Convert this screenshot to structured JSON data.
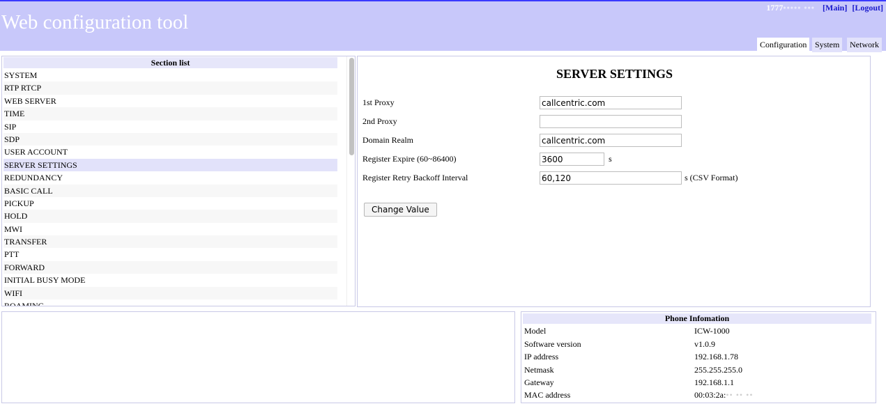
{
  "header": {
    "title": "Web configuration tool",
    "user_prefix": "1777",
    "user_redacted": "••••• •••",
    "main_link": "[Main]",
    "logout_link": "[Logout]"
  },
  "tabs": [
    {
      "label": "Configuration",
      "active": true
    },
    {
      "label": "System",
      "active": false
    },
    {
      "label": "Network",
      "active": false
    }
  ],
  "section_list": {
    "header": "Section list",
    "items": [
      "SYSTEM",
      "RTP RTCP",
      "WEB SERVER",
      "TIME",
      "SIP",
      "SDP",
      "USER ACCOUNT",
      "SERVER SETTINGS",
      "REDUNDANCY",
      "BASIC CALL",
      "PICKUP",
      "HOLD",
      "MWI",
      "TRANSFER",
      "PTT",
      "FORWARD",
      "INITIAL BUSY MODE",
      "WIFI",
      "ROAMING"
    ],
    "selected": "SERVER SETTINGS"
  },
  "settings": {
    "title": "SERVER SETTINGS",
    "fields": {
      "proxy1": {
        "label": "1st Proxy",
        "value": "callcentric.com"
      },
      "proxy2": {
        "label": "2nd Proxy",
        "value": ""
      },
      "domain": {
        "label": "Domain Realm",
        "value": "callcentric.com"
      },
      "expire": {
        "label": "Register Expire (60~86400)",
        "value": "3600",
        "unit": "s"
      },
      "retry": {
        "label": "Register Retry Backoff Interval",
        "value": "60,120",
        "unit": "s (CSV Format)"
      }
    },
    "button": "Change Value"
  },
  "phone_info": {
    "header": "Phone Infomation",
    "model": {
      "label": "Model",
      "value": "ICW-1000"
    },
    "software": {
      "label": "Software version",
      "value": "v1.0.9"
    },
    "ip": {
      "label": "IP address",
      "value": "192.168.1.78"
    },
    "netmask": {
      "label": "Netmask",
      "value": "255.255.255.0"
    },
    "gateway": {
      "label": "Gateway",
      "value": "192.168.1.1"
    },
    "mac": {
      "label": "MAC address",
      "value": "00:03:2a:",
      "redacted": "•• •• ••"
    }
  }
}
